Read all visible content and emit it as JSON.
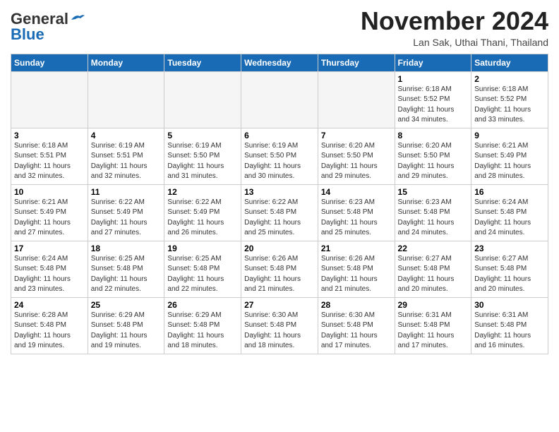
{
  "logo": {
    "general": "General",
    "blue": "Blue"
  },
  "title": "November 2024",
  "location": "Lan Sak, Uthai Thani, Thailand",
  "days_of_week": [
    "Sunday",
    "Monday",
    "Tuesday",
    "Wednesday",
    "Thursday",
    "Friday",
    "Saturday"
  ],
  "weeks": [
    [
      {
        "day": "",
        "info": ""
      },
      {
        "day": "",
        "info": ""
      },
      {
        "day": "",
        "info": ""
      },
      {
        "day": "",
        "info": ""
      },
      {
        "day": "",
        "info": ""
      },
      {
        "day": "1",
        "info": "Sunrise: 6:18 AM\nSunset: 5:52 PM\nDaylight: 11 hours\nand 34 minutes."
      },
      {
        "day": "2",
        "info": "Sunrise: 6:18 AM\nSunset: 5:52 PM\nDaylight: 11 hours\nand 33 minutes."
      }
    ],
    [
      {
        "day": "3",
        "info": "Sunrise: 6:18 AM\nSunset: 5:51 PM\nDaylight: 11 hours\nand 32 minutes."
      },
      {
        "day": "4",
        "info": "Sunrise: 6:19 AM\nSunset: 5:51 PM\nDaylight: 11 hours\nand 32 minutes."
      },
      {
        "day": "5",
        "info": "Sunrise: 6:19 AM\nSunset: 5:50 PM\nDaylight: 11 hours\nand 31 minutes."
      },
      {
        "day": "6",
        "info": "Sunrise: 6:19 AM\nSunset: 5:50 PM\nDaylight: 11 hours\nand 30 minutes."
      },
      {
        "day": "7",
        "info": "Sunrise: 6:20 AM\nSunset: 5:50 PM\nDaylight: 11 hours\nand 29 minutes."
      },
      {
        "day": "8",
        "info": "Sunrise: 6:20 AM\nSunset: 5:50 PM\nDaylight: 11 hours\nand 29 minutes."
      },
      {
        "day": "9",
        "info": "Sunrise: 6:21 AM\nSunset: 5:49 PM\nDaylight: 11 hours\nand 28 minutes."
      }
    ],
    [
      {
        "day": "10",
        "info": "Sunrise: 6:21 AM\nSunset: 5:49 PM\nDaylight: 11 hours\nand 27 minutes."
      },
      {
        "day": "11",
        "info": "Sunrise: 6:22 AM\nSunset: 5:49 PM\nDaylight: 11 hours\nand 27 minutes."
      },
      {
        "day": "12",
        "info": "Sunrise: 6:22 AM\nSunset: 5:49 PM\nDaylight: 11 hours\nand 26 minutes."
      },
      {
        "day": "13",
        "info": "Sunrise: 6:22 AM\nSunset: 5:48 PM\nDaylight: 11 hours\nand 25 minutes."
      },
      {
        "day": "14",
        "info": "Sunrise: 6:23 AM\nSunset: 5:48 PM\nDaylight: 11 hours\nand 25 minutes."
      },
      {
        "day": "15",
        "info": "Sunrise: 6:23 AM\nSunset: 5:48 PM\nDaylight: 11 hours\nand 24 minutes."
      },
      {
        "day": "16",
        "info": "Sunrise: 6:24 AM\nSunset: 5:48 PM\nDaylight: 11 hours\nand 24 minutes."
      }
    ],
    [
      {
        "day": "17",
        "info": "Sunrise: 6:24 AM\nSunset: 5:48 PM\nDaylight: 11 hours\nand 23 minutes."
      },
      {
        "day": "18",
        "info": "Sunrise: 6:25 AM\nSunset: 5:48 PM\nDaylight: 11 hours\nand 22 minutes."
      },
      {
        "day": "19",
        "info": "Sunrise: 6:25 AM\nSunset: 5:48 PM\nDaylight: 11 hours\nand 22 minutes."
      },
      {
        "day": "20",
        "info": "Sunrise: 6:26 AM\nSunset: 5:48 PM\nDaylight: 11 hours\nand 21 minutes."
      },
      {
        "day": "21",
        "info": "Sunrise: 6:26 AM\nSunset: 5:48 PM\nDaylight: 11 hours\nand 21 minutes."
      },
      {
        "day": "22",
        "info": "Sunrise: 6:27 AM\nSunset: 5:48 PM\nDaylight: 11 hours\nand 20 minutes."
      },
      {
        "day": "23",
        "info": "Sunrise: 6:27 AM\nSunset: 5:48 PM\nDaylight: 11 hours\nand 20 minutes."
      }
    ],
    [
      {
        "day": "24",
        "info": "Sunrise: 6:28 AM\nSunset: 5:48 PM\nDaylight: 11 hours\nand 19 minutes."
      },
      {
        "day": "25",
        "info": "Sunrise: 6:29 AM\nSunset: 5:48 PM\nDaylight: 11 hours\nand 19 minutes."
      },
      {
        "day": "26",
        "info": "Sunrise: 6:29 AM\nSunset: 5:48 PM\nDaylight: 11 hours\nand 18 minutes."
      },
      {
        "day": "27",
        "info": "Sunrise: 6:30 AM\nSunset: 5:48 PM\nDaylight: 11 hours\nand 18 minutes."
      },
      {
        "day": "28",
        "info": "Sunrise: 6:30 AM\nSunset: 5:48 PM\nDaylight: 11 hours\nand 17 minutes."
      },
      {
        "day": "29",
        "info": "Sunrise: 6:31 AM\nSunset: 5:48 PM\nDaylight: 11 hours\nand 17 minutes."
      },
      {
        "day": "30",
        "info": "Sunrise: 6:31 AM\nSunset: 5:48 PM\nDaylight: 11 hours\nand 16 minutes."
      }
    ]
  ]
}
